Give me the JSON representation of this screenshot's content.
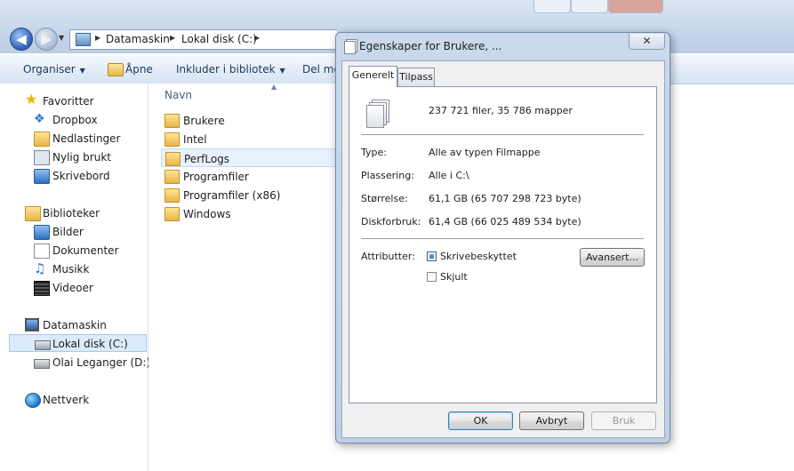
{
  "explorer": {
    "breadcrumbs": [
      "Datamaskin",
      "Lokal disk (C:)"
    ],
    "toolbar": {
      "organize": "Organiser",
      "open": "Åpne",
      "include": "Inkluder i bibliotek",
      "share": "Del me"
    },
    "column_header": "Navn",
    "nav": {
      "favorites": "Favoritter",
      "dropbox": "Dropbox",
      "downloads": "Nedlastinger",
      "recent": "Nylig brukt",
      "desktop": "Skrivebord",
      "libraries": "Biblioteker",
      "pictures": "Bilder",
      "documents": "Dokumenter",
      "music": "Musikk",
      "videos": "Videoer",
      "computer": "Datamaskin",
      "local_disk": "Lokal disk (C:)",
      "drive_d": "Olai Leganger (D:)",
      "network": "Nettverk"
    },
    "files": [
      "Brukere",
      "Intel",
      "PerfLogs",
      "Programfiler",
      "Programfiler (x86)",
      "Windows"
    ]
  },
  "dialog": {
    "title": "Egenskaper for Brukere, ...",
    "close": "✕",
    "tabs": [
      "Generelt",
      "Tilpass"
    ],
    "summary": "237 721 filer, 35 786 mapper",
    "type_label": "Type:",
    "type_value": "Alle av typen Filmappe",
    "location_label": "Plassering:",
    "location_value": "Alle i C:\\",
    "size_label": "Størrelse:",
    "size_value": "61,1 GB (65 707 298 723 byte)",
    "disk_label": "Diskforbruk:",
    "disk_value": "61,4 GB (66 025 489 534 byte)",
    "attributes_label": "Attributter:",
    "readonly_label": "Skrivebeskyttet",
    "hidden_label": "Skjult",
    "advanced_button": "Avansert...",
    "ok": "OK",
    "cancel": "Avbryt",
    "apply": "Bruk"
  }
}
